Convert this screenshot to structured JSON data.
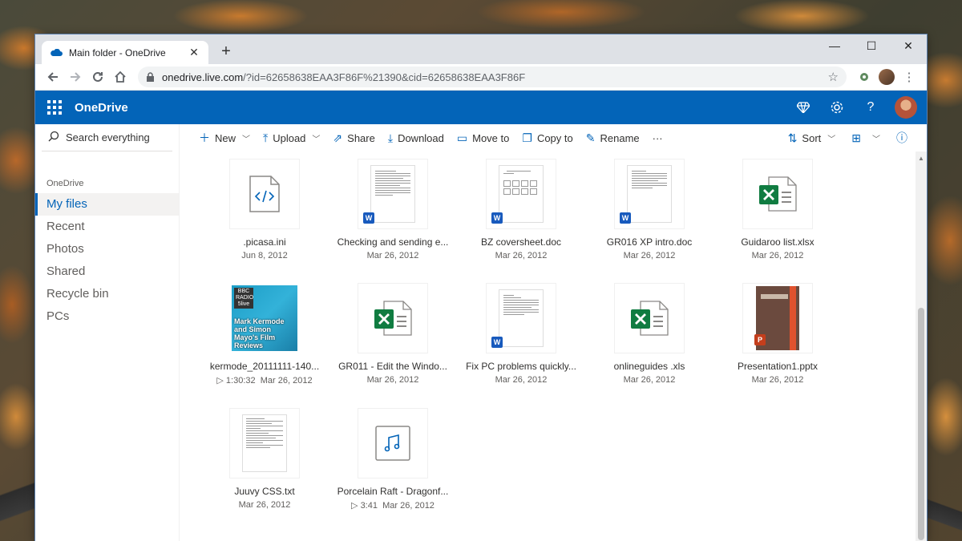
{
  "browser": {
    "tab_title": "Main folder - OneDrive",
    "new_tab": "+",
    "url_host": "onedrive.live.com",
    "url_path": "/?id=62658638EAA3F86F%21390&cid=62658638EAA3F86F",
    "win_minimize": "—",
    "win_maximize": "☐",
    "win_close": "✕"
  },
  "onedrive": {
    "brand": "OneDrive",
    "accent": "#0364b8"
  },
  "search": {
    "placeholder": "Search everything"
  },
  "sidebar": {
    "heading": "OneDrive",
    "items": [
      {
        "label": "My files",
        "active": true
      },
      {
        "label": "Recent"
      },
      {
        "label": "Photos"
      },
      {
        "label": "Shared"
      },
      {
        "label": "Recycle bin"
      },
      {
        "label": "PCs"
      }
    ]
  },
  "commands": {
    "new": "New",
    "upload": "Upload",
    "share": "Share",
    "download": "Download",
    "move_to": "Move to",
    "copy_to": "Copy to",
    "rename": "Rename",
    "more": "···",
    "sort": "Sort"
  },
  "files": [
    {
      "name": ".picasa.ini",
      "date": "Jun 8, 2012",
      "type": "code-icon"
    },
    {
      "name": "Checking and sending e...",
      "date": "Mar 26, 2012",
      "type": "word"
    },
    {
      "name": "BZ coversheet.doc",
      "date": "Mar 26, 2012",
      "type": "word"
    },
    {
      "name": "GR016 XP intro.doc",
      "date": "Mar 26, 2012",
      "type": "word"
    },
    {
      "name": "Guidaroo list.xlsx",
      "date": "Mar 26, 2012",
      "type": "excel"
    },
    {
      "name": "kermode_20111111-140...",
      "duration": "1:30:32",
      "date": "Mar 26, 2012",
      "type": "audio-art",
      "art_text": "Mark Kermode and Simon Mayo's Film Reviews",
      "art_badge": "BBC RADIO 5live"
    },
    {
      "name": "GR011 - Edit the Windo...",
      "date": "Mar 26, 2012",
      "type": "excel"
    },
    {
      "name": "Fix PC problems quickly...",
      "date": "Mar 26, 2012",
      "type": "word"
    },
    {
      "name": "onlineguides .xls",
      "date": "Mar 26, 2012",
      "type": "excel"
    },
    {
      "name": "Presentation1.pptx",
      "date": "Mar 26, 2012",
      "type": "powerpoint"
    },
    {
      "name": "Juuvy CSS.txt",
      "date": "Mar 26, 2012",
      "type": "text"
    },
    {
      "name": "Porcelain Raft - Dragonf...",
      "duration": "3:41",
      "date": "Mar 26, 2012",
      "type": "music-icon"
    }
  ]
}
